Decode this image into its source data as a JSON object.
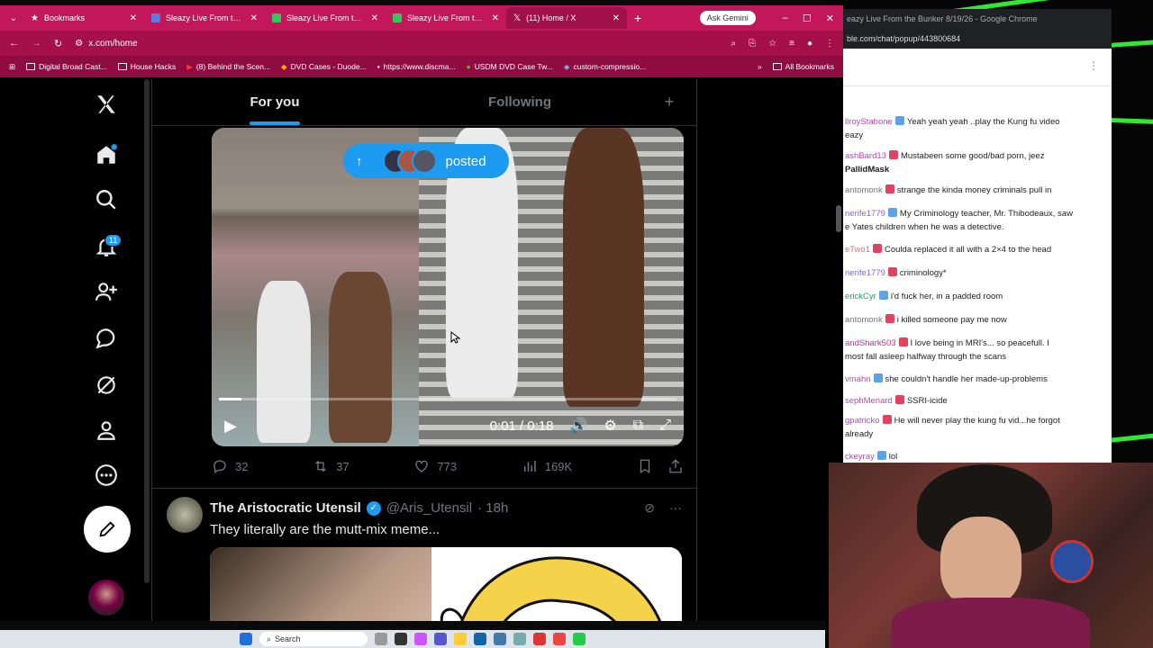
{
  "browser": {
    "tabs": [
      {
        "label": "Bookmarks",
        "color": "#ffffff"
      },
      {
        "label": "Sleazy Live From the Bu",
        "color": "#5b7be0"
      },
      {
        "label": "Sleazy Live From the Bu",
        "color": "#34c759"
      },
      {
        "label": "Sleazy Live From the Bu",
        "color": "#34c759"
      },
      {
        "label": "(11) Home / X",
        "color": "#000000"
      }
    ],
    "gemini_label": "Ask Gemini",
    "url": "x.com/home",
    "bookmarks": [
      "Digital Broad Cast...",
      "House Hacks",
      "(8) Behind the Scen...",
      "DVD Cases - Duode...",
      "https://www.discma...",
      "USDM DVD Case Tw...",
      "custom-compressio..."
    ],
    "all_bookmarks": "All Bookmarks"
  },
  "x": {
    "notification_count": "11",
    "tab_for_you": "For you",
    "tab_following": "Following",
    "plus": "+",
    "posted_label": "posted",
    "video_time": "0:01 / 0:18",
    "video_progress_fraction": 0.05,
    "actions": {
      "replies": "32",
      "reposts": "37",
      "likes": "773",
      "views": "169K"
    },
    "tweet2": {
      "name": "The Aristocratic Utensil",
      "handle": "@Aris_Utensil",
      "time": "· 18h",
      "text": "They literally are the mutt-mix meme..."
    }
  },
  "chat": {
    "window_title": "eazy Live From the Bunker 8/19/26 - Google Chrome",
    "url": "ble.com/chat/popup/443800684",
    "messages": [
      {
        "user": "llroyStabone",
        "text": "Yeah yeah yeah ..play the Kung fu video",
        "cont": "eazy",
        "ucolor": "#c040c0"
      },
      {
        "user": "ashBard13",
        "text": "Mustabeen some good/bad porn, jeez",
        "cont": "PallidMask",
        "ucolor": "#c040c0"
      },
      {
        "user": "antomonk",
        "text": "strange the kinda money criminals pull in",
        "cont": "",
        "ucolor": "#777777"
      },
      {
        "user": "nerife1779",
        "text": "My Criminology teacher, Mr. Thibodeaux, saw",
        "cont": "e Yates children when he was a detective.",
        "ucolor": "#8a5cf0"
      },
      {
        "user": "eTwo1",
        "text": "Coulda replaced it all with a 2×4 to the head",
        "cont": "",
        "ucolor": "#e07070"
      },
      {
        "user": "nerife1779",
        "text": "criminology*",
        "cont": "",
        "ucolor": "#8a5cf0"
      },
      {
        "user": "erickCyr",
        "text": "i'd fuck her, in a padded room",
        "cont": "",
        "ucolor": "#20a060"
      },
      {
        "user": "antomonk",
        "text": "i killed someone pay me now",
        "cont": "",
        "ucolor": "#777777"
      },
      {
        "user": "andShark503",
        "text": "I love being in MRI's... so peacefull. I",
        "cont": "most fall asleep halfway through the scans",
        "ucolor": "#c03090"
      },
      {
        "user": "vmahn",
        "text": "she couldn't handle her made-up-problems",
        "cont": "",
        "ucolor": "#c040c0"
      },
      {
        "user": "sephMenard",
        "text": "SSRI-icide",
        "cont": "",
        "ucolor": "#c040c0"
      },
      {
        "user": "gpatricko",
        "text": "He will never play the kung fu vid...he forgot",
        "cont": "already",
        "ucolor": "#c040c0"
      },
      {
        "user": "ckeyray",
        "text": "lol",
        "cont": "",
        "ucolor": "#c040c0"
      }
    ]
  },
  "taskbar": {
    "search_placeholder": "Search"
  },
  "colors": {
    "tabbar": "#c2185b",
    "accent": "#1d9bf0",
    "stripes": "#39ff3a"
  }
}
